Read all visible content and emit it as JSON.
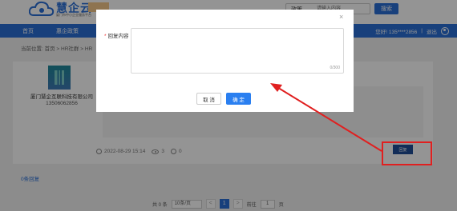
{
  "header": {
    "logo_text": "慧企云",
    "logo_sub": "厦门市中小企业服务平台",
    "search_type": "政策 ⌄",
    "search_placeholder": "请输入内容",
    "search_button": "搜索"
  },
  "nav": {
    "items": [
      "首页",
      "惠企政策"
    ],
    "user_info": "您好! 135****2856",
    "logout": "退出"
  },
  "breadcrumb": "当前位置: 首页 > HR社群 > HR",
  "post": {
    "company": "厦门慧企互联科技有限公司",
    "phone": "13506062856",
    "date": "2022-08-29 15:14",
    "views": "3",
    "comments": "0",
    "reply_button": "回复"
  },
  "reply_count": "0条回复",
  "pagination": {
    "total": "共 0 条",
    "page_size": "10条/页",
    "prev": "<",
    "current": "1",
    "next": ">",
    "goto_label": "前往",
    "goto_value": "1",
    "page_unit": "页"
  },
  "modal": {
    "close": "×",
    "required_mark": "*",
    "label": "回复内容",
    "char_count": "0/300",
    "cancel": "取 消",
    "confirm": "确 定"
  },
  "colors": {
    "brand": "#2a6fd6",
    "annotation": "#e02020"
  }
}
